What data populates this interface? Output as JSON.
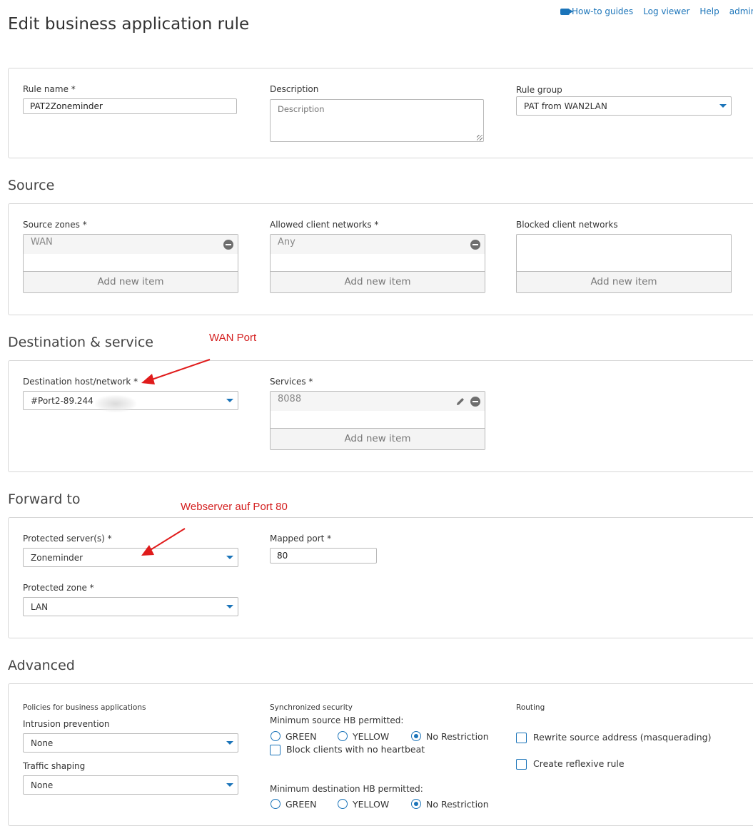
{
  "header": {
    "title": "Edit business application rule",
    "links": [
      "How-to guides",
      "Log viewer",
      "Help",
      "admin"
    ]
  },
  "rule": {
    "name_label": "Rule name *",
    "name_value": "PAT2Zoneminder",
    "description_label": "Description",
    "description_placeholder": "Description",
    "group_label": "Rule group",
    "group_value": "PAT from WAN2LAN"
  },
  "source": {
    "title": "Source",
    "zones_label": "Source zones *",
    "zones_items": [
      "WAN"
    ],
    "allowed_label": "Allowed client networks *",
    "allowed_items": [
      "Any"
    ],
    "blocked_label": "Blocked client networks",
    "add_label": "Add new item"
  },
  "destination": {
    "title": "Destination & service",
    "host_label": "Destination host/network *",
    "host_value": "#Port2-89.244",
    "services_label": "Services *",
    "services_items": [
      "8088"
    ],
    "add_label": "Add new item",
    "annotation": "WAN Port"
  },
  "forward": {
    "title": "Forward to",
    "servers_label": "Protected server(s) *",
    "servers_value": "Zoneminder",
    "mapped_label": "Mapped port *",
    "mapped_value": "80",
    "zone_label": "Protected zone *",
    "zone_value": "LAN",
    "annotation": "Webserver auf Port 80"
  },
  "advanced": {
    "title": "Advanced",
    "policies_title": "Policies for business applications",
    "ips_label": "Intrusion prevention",
    "ips_value": "None",
    "shaping_label": "Traffic shaping",
    "shaping_value": "None",
    "sync_title": "Synchronized security",
    "min_source_label": "Minimum source HB permitted:",
    "min_dest_label": "Minimum destination HB permitted:",
    "hb_options": [
      "GREEN",
      "YELLOW",
      "No Restriction"
    ],
    "hb_selected": "No Restriction",
    "block_clients_label": "Block clients with no heartbeat",
    "routing_title": "Routing",
    "masq_label": "Rewrite source address (masquerading)",
    "reflexive_label": "Create reflexive rule"
  },
  "colors": {
    "accent": "#1b74b9",
    "annotation": "#d42020",
    "border": "#b9b9b9"
  }
}
